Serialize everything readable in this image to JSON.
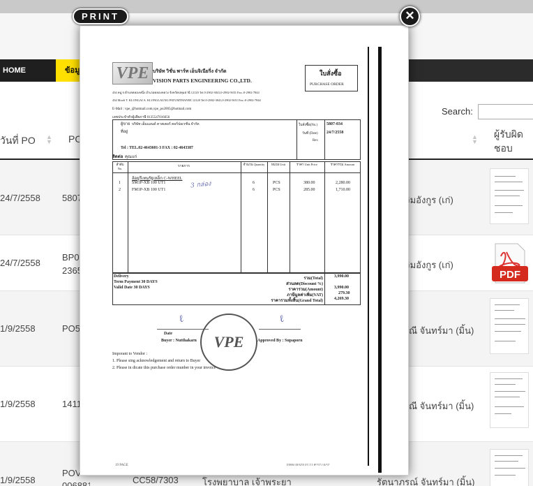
{
  "nav": {
    "home": "HOME",
    "active_item": "ข้อมูล"
  },
  "search": {
    "label": "Search:",
    "value": ""
  },
  "table": {
    "headers": [
      "วันที่ PO",
      "PO",
      "ผู้รับผิดชอบ"
    ],
    "rows": [
      {
        "date": "24/7/2558",
        "po": "5807",
        "responsible": "จิมอังกูร (เก่)",
        "attachment": "document"
      },
      {
        "date": "24/7/2558",
        "po": "BP0 2365",
        "responsible": "จิมอังกูร (เก่)",
        "attachment": "pdf"
      },
      {
        "date": "1/9/2558",
        "po": "PO5",
        "responsible": "ณี จันทร์มา (มิ้น)",
        "attachment": "document"
      },
      {
        "date": "1/9/2558",
        "po": "1411",
        "responsible": "ณี จันทร์มา (มิ้น)",
        "attachment": "document"
      },
      {
        "date": "1/9/2558",
        "po": "POV 006881",
        "extra1": "CC58/7303",
        "extra2": "โรงพยาบาล เจ้าพระยา",
        "responsible": "รัตนาภรณ์ จันทร์มา (มิ้น)",
        "attachment": "document"
      }
    ]
  },
  "pdf_label": "PDF",
  "overlay": {
    "print_label": "PRINT",
    "close_symbol": "✕",
    "document": {
      "company_th": "บริษัท วิชั่น พาร์ท เอ็นจิเนียริ่ง จำกัด",
      "company_en": "VISION PARTS ENGINEERING CO.,LTD.",
      "address_1": "434 หมู่ 6 ตำบลคลองหนึ่ง อำเภอคลองหลวง จังหวัดปทุมธานี 12120 Tel.0-2902-3841,0-2902-5651 Fax.:0-2902-7844",
      "address_2": "434 Moo6 T. KLONGAI A. KLONGLAUNG PATUMTHANEE 12120 Tel.0-2902-3841,0-2902-5651 Fax.:0-2902-7844",
      "email": "E-Mail : vpe_@hotmail.com,vpe_po2005@hotmail.com",
      "tax_id": "เลขประจำตัวผู้เสียภาษี 0135547016656",
      "po_title_th": "ใบสั่งซื้อ",
      "po_title_en": "PURCHASE ORDER",
      "vendor_label": "ผู้ขาย",
      "vendor_name": "บริษัท เอ็มแอนด์ คาสเตอร์ คอร์ปอเรชั่น จำกัด",
      "address_label": "ที่อยู่",
      "tel_line": "Tel : TEL.02-4643601-3   FAX : 02-4643387",
      "contact_label": "ติดต่อ",
      "contact_name": "คุณแก่",
      "po_no_label": "ใบสั่งซื้อ(No.)",
      "po_no": "5807-034",
      "date_label": "วันที่ (Date)",
      "date": "24/7/2558",
      "rev_label": "Rev.",
      "columns": [
        "ลำดับ No.",
        "รายการ",
        "จำนวน Quantity",
        "หน่วย Unit",
        "ราคา Unit Price",
        "ราคารวม Amount"
      ],
      "group_title": "ล้อยูรีเทนรัฐเหล็ก C-WHEEL",
      "items": [
        {
          "no": "1",
          "desc": "SM1P-XB 100 UT1",
          "qty": "6",
          "unit": "PCS",
          "price": "380.00",
          "amount": "2,280.00"
        },
        {
          "no": "2",
          "desc": "FM1P-XB 100 UT1",
          "qty": "6",
          "unit": "PCS",
          "price": "285.00",
          "amount": "1,710.00"
        }
      ],
      "handwritten": "3 กล่อง",
      "delivery": "Delivery",
      "term_payment": "Term Payment  30  DAYS",
      "valid_date": "Valid Date       30  DAYS",
      "totals": [
        {
          "label": "รวม(Total)",
          "value": "3,990.00"
        },
        {
          "label": "ส่วนลด(Discount %)",
          "value": ""
        },
        {
          "label": "ราคารวม(Amount)",
          "value": "3,990.00"
        },
        {
          "label": "ภาษีมูลค่าเพิ่ม(VAT)",
          "value": "279.30"
        },
        {
          "label": "ราคารวมทั้งสิ้น(Grand Total)",
          "value": "4,269.30"
        }
      ],
      "stamp_text": "VPE",
      "date_sig_label": "Date",
      "buyer_line": "Buyer : Nutthakarn",
      "approved_line": "Approved By : Supaporn",
      "note_title": "Imporant to Vendor :",
      "note_1": "1. Please sing acknowledgement and return to Buyer",
      "note_2": "2. Please in dicate this purchase order munber in your invoice",
      "fax_footer": "25/07/2558  11:14  0293078844",
      "fax_left": "19   PAGE"
    }
  }
}
